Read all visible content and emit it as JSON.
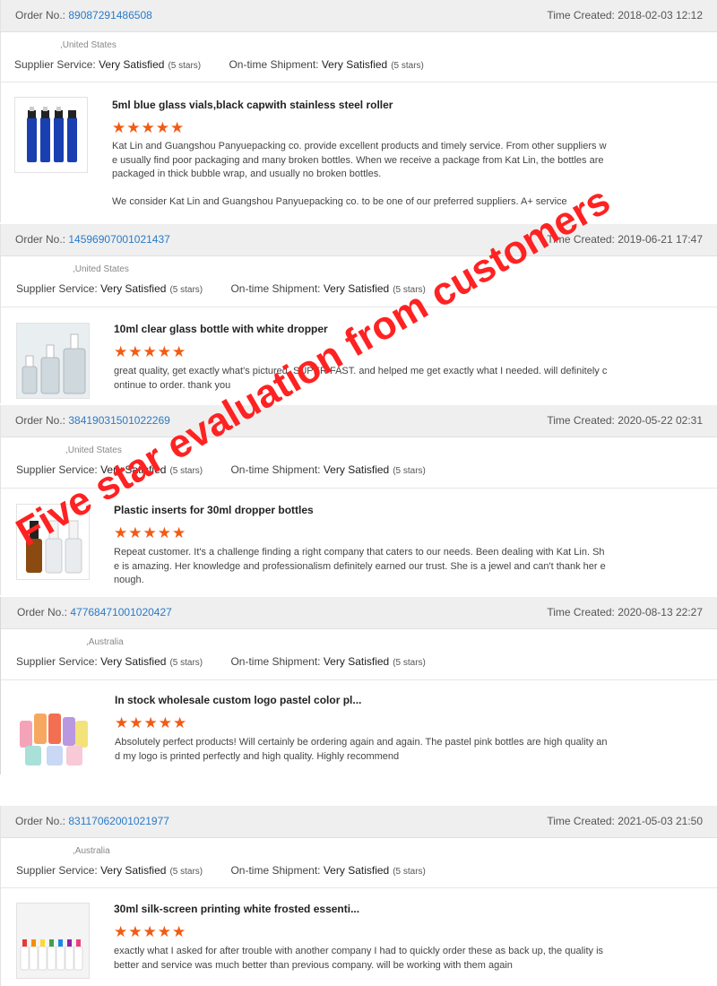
{
  "stars": "★★★★★",
  "labels": {
    "order_no": "Order No.:",
    "time_created": "Time Created:",
    "supplier_service": "Supplier Service:",
    "ontime_shipment": "On-time Shipment:",
    "rating": "Very Satisfied",
    "rating_stars": "(5 stars)"
  },
  "reviews": [
    {
      "order_no": "89087291486508",
      "time": "2018-02-03 12:12",
      "country": ",United States",
      "product": "5ml blue glass vials,black capwith stainless steel roller",
      "text": [
        "Kat Lin and Guangshou Panyuepacking co. provide excellent products and timely service.  From other suppliers we usually find poor packaging and many broken bottles.  When we receive a package from Kat Lin, the bottles are packaged in thick bubble wrap, and usually no broken bottles.",
        "We consider Kat Lin and Guangshou Panyuepacking co. to be one of our preferred suppliers.  A+ service"
      ]
    },
    {
      "order_no": "14596907001021437",
      "time": "2019-06-21 17:47",
      "country": ",United States",
      "product": "10ml clear glass bottle with white dropper",
      "text": [
        "great quality, get exactly what's pictured. SUPER FAST. and helped me get exactly what I needed. will definitely continue to order. thank you"
      ]
    },
    {
      "order_no": "38419031501022269",
      "time": "2020-05-22 02:31",
      "country": ",United States",
      "product": "Plastic inserts for 30ml dropper bottles",
      "text": [
        "Repeat customer. It's a challenge finding a right company that caters to our needs. Been dealing with Kat Lin. She is amazing. Her knowledge and professionalism definitely earned our trust. She is a jewel and can't thank her enough."
      ]
    },
    {
      "order_no": "47768471001020427",
      "time": "2020-08-13 22:27",
      "country": ",Australia",
      "product": "In stock wholesale custom logo pastel color pl...",
      "text": [
        "Absolutely perfect products! Will certainly be ordering again and again. The pastel pink bottles are high quality and my logo is printed perfectly and high quality. Highly recommend"
      ]
    },
    {
      "order_no": "83117062001021977",
      "time": "2021-05-03 21:50",
      "country": ",Australia",
      "product": "30ml silk-screen printing white frosted essenti...",
      "text": [
        "exactly what I asked for after trouble with another company I had to quickly order these as back up, the quality is better and service was much better than previous company. will be working with them again"
      ]
    }
  ],
  "watermark": "Five star evaluation from customers",
  "colors": {
    "link": "#2a7ac7",
    "stars": "#f25b14",
    "watermark": "#ff2222",
    "header_bg": "#efefef"
  }
}
